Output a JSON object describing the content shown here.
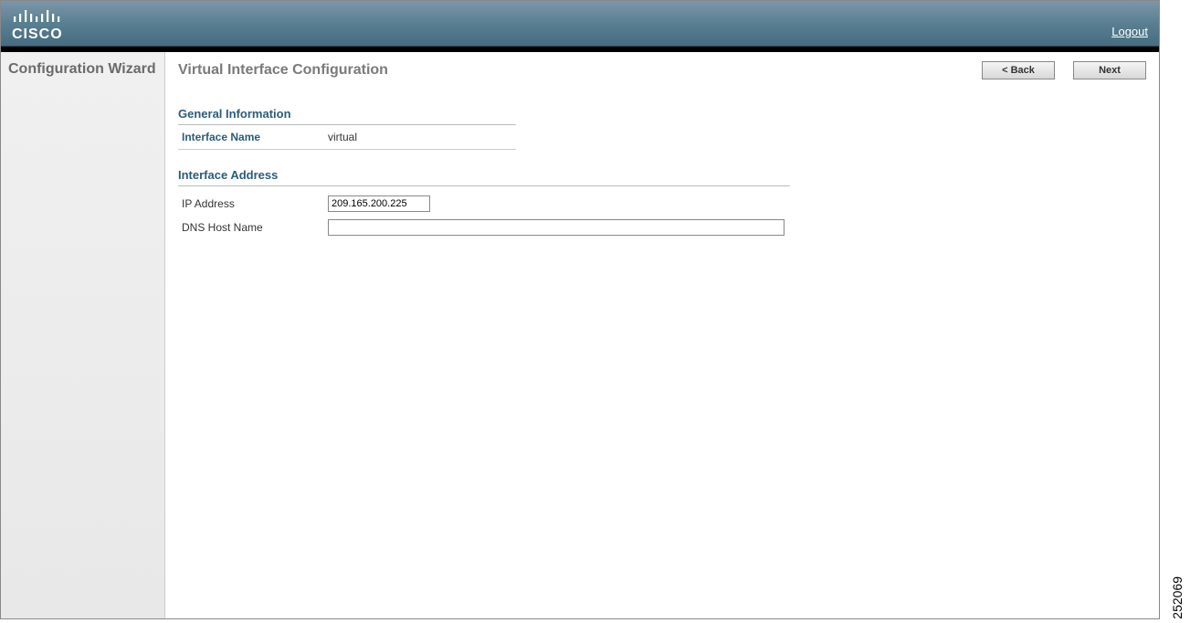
{
  "header": {
    "logout_label": "Logout"
  },
  "sidebar": {
    "title": "Configuration Wizard"
  },
  "main": {
    "page_title": "Virtual Interface Configuration",
    "back_label": "< Back",
    "next_label": "Next"
  },
  "general": {
    "section_title": "General Information",
    "interface_name_label": "Interface Name",
    "interface_name_value": "virtual"
  },
  "address": {
    "section_title": "Interface Address",
    "ip_address_label": "IP Address",
    "ip_address_value": "209.165.200.225",
    "dns_host_name_label": "DNS Host Name",
    "dns_host_name_value": ""
  },
  "image_id": "252069"
}
